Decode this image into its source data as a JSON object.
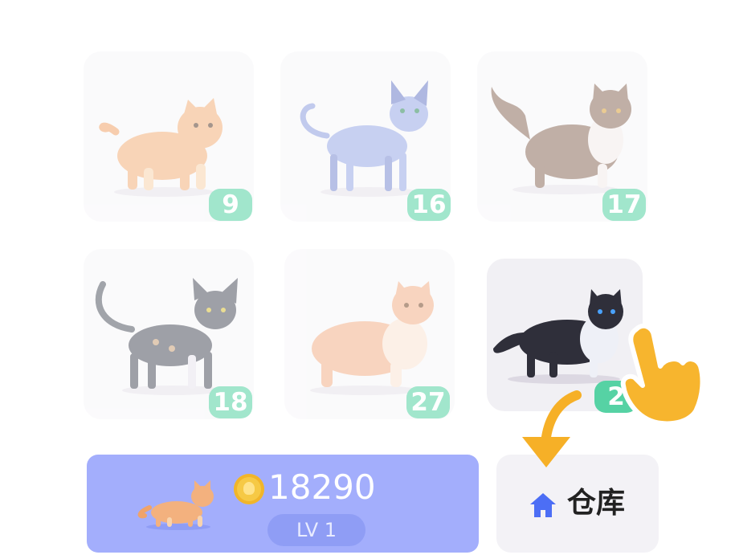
{
  "cat_grid": {
    "cards": [
      {
        "level": "9"
      },
      {
        "level": "16"
      },
      {
        "level": "17"
      },
      {
        "level": "18"
      },
      {
        "level": "27"
      },
      {
        "level": "2"
      }
    ]
  },
  "buy_button": {
    "price": "18290",
    "level_label": "LV 1"
  },
  "storage_button": {
    "label": "仓库"
  },
  "tutorial": {
    "hint": "tap-storage"
  },
  "colors": {
    "badge": "#56d2a4",
    "buy_bg": "#a3aefc",
    "house_icon": "#4c6ef5",
    "arrow": "#f6b027"
  }
}
